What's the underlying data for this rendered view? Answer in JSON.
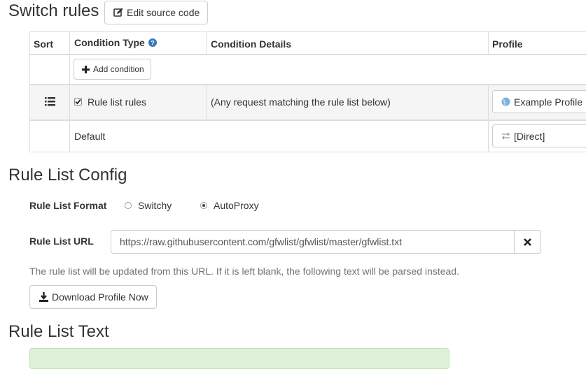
{
  "switch_rules": {
    "title": "Switch rules",
    "edit_source_label": "Edit source code"
  },
  "table": {
    "headers": {
      "sort": "Sort",
      "condition_type": "Condition Type",
      "condition_details": "Condition Details",
      "profile": "Profile"
    },
    "add_condition_label": "Add condition",
    "rows": [
      {
        "condition_type": "Rule list rules",
        "checked": true,
        "details": "(Any request matching the rule list below)",
        "profile": "Example Profile",
        "profile_icon": "globe-icon"
      },
      {
        "condition_type": "Default",
        "profile": "[Direct]",
        "profile_icon": "exchange-icon"
      }
    ]
  },
  "rule_list_config": {
    "title": "Rule List Config",
    "format_label": "Rule List Format",
    "format_options": [
      "Switchy",
      "AutoProxy"
    ],
    "format_selected": "AutoProxy",
    "url_label": "Rule List URL",
    "url_value": "https://raw.githubusercontent.com/gfwlist/gfwlist/master/gfwlist.txt",
    "help_text": "The rule list will be updated from this URL. If it is left blank, the following text will be parsed instead.",
    "download_label": "Download Profile Now"
  },
  "rule_list_text": {
    "title": "Rule List Text"
  },
  "colors": {
    "accent": "#337ab7",
    "textarea_bg": "#dff0d8",
    "textarea_border": "#c3e3b5",
    "border": "#dddddd",
    "row_alt": "#f5f5f5"
  }
}
